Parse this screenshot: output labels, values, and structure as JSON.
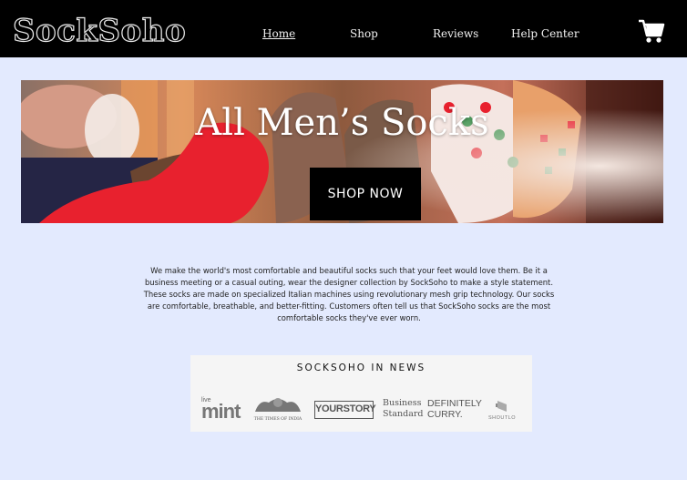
{
  "header": {
    "logo": "SockSoho",
    "nav": [
      {
        "label": "Home",
        "active": true
      },
      {
        "label": "Shop",
        "active": false
      },
      {
        "label": "Reviews",
        "active": false
      },
      {
        "label": "Help Center",
        "active": false
      }
    ],
    "cart_icon": "shopping-cart-icon"
  },
  "hero": {
    "title": "All Men’s Socks",
    "button": "SHOP NOW"
  },
  "description": "We make the world's most comfortable and beautiful socks such that your feet would love them. Be it a business meeting or a casual outing, wear the designer collection by SockSoho to make a style statement. These socks are made on specialized Italian machines using revolutionary mesh grip technology. Our socks are comfortable, breathable, and better-fitting. Customers often tell us that SockSoho socks are the most comfortable socks they've ever worn.",
  "news": {
    "title": "SOCKSOHO IN NEWS",
    "logos": {
      "livemint_small": "live",
      "livemint_big": "mint",
      "toi": "THE TIMES OF INDIA",
      "yourstory": "YOURSTORY",
      "bs_1": "Business",
      "bs_2": "Standard",
      "dc_1": "DEFINITELY",
      "dc_2": "CURRY.",
      "shoutlo": "SHOUTLO"
    }
  },
  "colors": {
    "page_bg": "#e3eafe",
    "header_bg": "#000000",
    "button_bg": "#000000",
    "sock_red": "#e8212e"
  }
}
